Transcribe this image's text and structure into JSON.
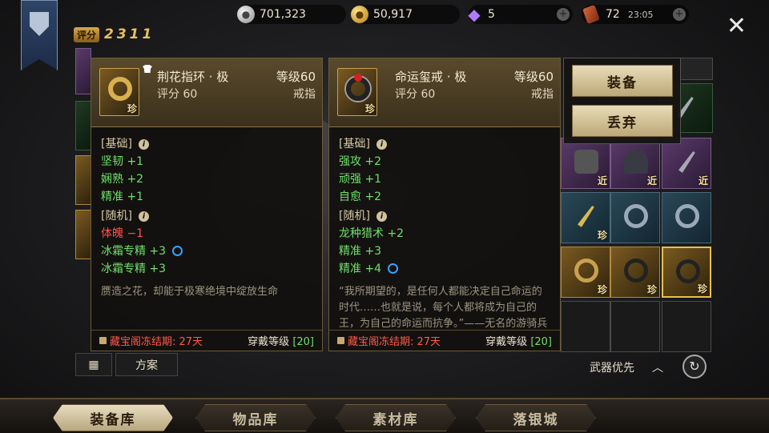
{
  "resources": {
    "silver": "701,323",
    "gold": "50,917",
    "gem": "5",
    "stamina": "72",
    "timer": "23:05"
  },
  "score": {
    "label": "评分",
    "value": "2311"
  },
  "left_item": {
    "name": "荆花指环 · 极",
    "level": "等级60",
    "score": "评分 60",
    "type": "戒指",
    "rarity": "珍",
    "basic_label": "[基础]",
    "basic_stats": [
      "坚韧 +1",
      "娴熟 +2",
      "精准 +1"
    ],
    "random_label": "[随机]",
    "random_stats": [
      "体魄 −1",
      "冰霜专精 +3",
      "冰霜专精 +3"
    ],
    "description": "赝造之花，却能于极寒绝境中绽放生命",
    "lock_text": "藏宝阁冻结期: 27天",
    "wear_label": "穿戴等级",
    "wear_level": "[20]"
  },
  "right_item": {
    "name": "命运玺戒 · 极",
    "level": "等级60",
    "score": "评分 60",
    "type": "戒指",
    "rarity": "珍",
    "basic_label": "[基础]",
    "basic_stats": [
      "强攻 +2",
      "顽强 +1",
      "自愈 +2"
    ],
    "random_label": "[随机]",
    "random_stats": [
      "龙种猎术 +2",
      "精准 +3",
      "精准 +4"
    ],
    "description": "“我所期望的，是任何人都能决定自己命运的时代……也就是说，每个人都将成为自己的王，为自己的命运而抗争。”——无名的游骑兵",
    "lock_text": "藏宝阁冻结期: 27天",
    "wear_label": "穿戴等级",
    "wear_level": "[20]"
  },
  "actions": {
    "equip": "装备",
    "discard": "丢弃"
  },
  "toolbar": {
    "scheme": "方案"
  },
  "sort": {
    "label": "武器优先"
  },
  "tabs": [
    "装备库",
    "物品库",
    "素材库",
    "落银城"
  ],
  "grid_tags": {
    "near": "近",
    "rare": "珍"
  }
}
